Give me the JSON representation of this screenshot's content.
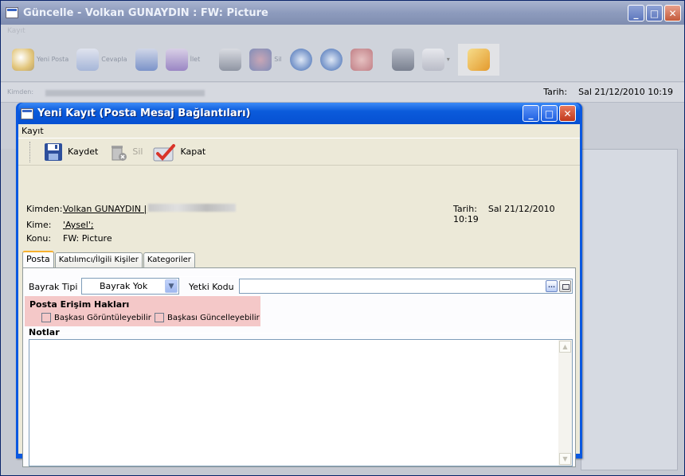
{
  "background_window": {
    "title": "Güncelle - Volkan GUNAYDIN : FW: Picture",
    "menu_label": "Kayıt",
    "toolbar": [
      {
        "label": "Yeni Posta",
        "icon": "new-mail-icon"
      },
      {
        "label": "Cevapla",
        "icon": "reply-icon"
      },
      {
        "label": "",
        "icon": "forward-icon"
      },
      {
        "label": "İlet",
        "icon": "forward-all-icon"
      },
      {
        "label": "",
        "icon": "save-icon"
      },
      {
        "label": "Sil",
        "icon": "delete-icon"
      },
      {
        "label": "",
        "icon": "prev-icon"
      },
      {
        "label": "",
        "icon": "next-icon"
      },
      {
        "label": "",
        "icon": "check-icon"
      },
      {
        "label": "",
        "icon": "people-icon"
      },
      {
        "label": "",
        "icon": "calendar-icon"
      },
      {
        "label": "",
        "icon": "edit-note-icon"
      }
    ],
    "kimden_label": "Kimden:",
    "date_label": "Tarih:",
    "date_value": "Sal 21/12/2010 10:19"
  },
  "dialog": {
    "title": "Yeni Kayıt (Posta Mesaj Bağlantıları)",
    "menu": {
      "kayit": "Kayıt"
    },
    "toolbar": {
      "save": "Kaydet",
      "delete": "Sil",
      "close": "Kapat"
    },
    "info": {
      "from_label": "Kimden:",
      "from_value": "Volkan GUNAYDIN",
      "to_label": "Kime:",
      "to_value": "'Aysel';",
      "subject_label": "Konu:",
      "subject_value": "FW: Picture",
      "date_label": "Tarih:",
      "date_value": "Sal 21/12/2010 10:19"
    },
    "tabs": [
      {
        "label": "Posta",
        "active": true
      },
      {
        "label": "Katılımcı/İlgili Kişiler",
        "active": false
      },
      {
        "label": "Kategoriler",
        "active": false
      }
    ],
    "posta": {
      "flag_type_label": "Bayrak Tipi",
      "flag_type_value": "Bayrak Yok",
      "authority_label": "Yetki Kodu",
      "authority_value": "",
      "browse_button": "...",
      "access_title": "Posta Erişim Hakları",
      "can_view_label": "Başkası Görüntüleyebilir",
      "can_view_checked": false,
      "can_update_label": "Başkası Güncelleyebilir",
      "can_update_checked": false,
      "notes_title": "Notlar",
      "notes_value": ""
    }
  },
  "colors": {
    "xp_blue": "#0a58e0",
    "dialog_bg": "#ece9d8",
    "highlight": "#f4c8c8",
    "tab_accent": "#f7b12f"
  }
}
